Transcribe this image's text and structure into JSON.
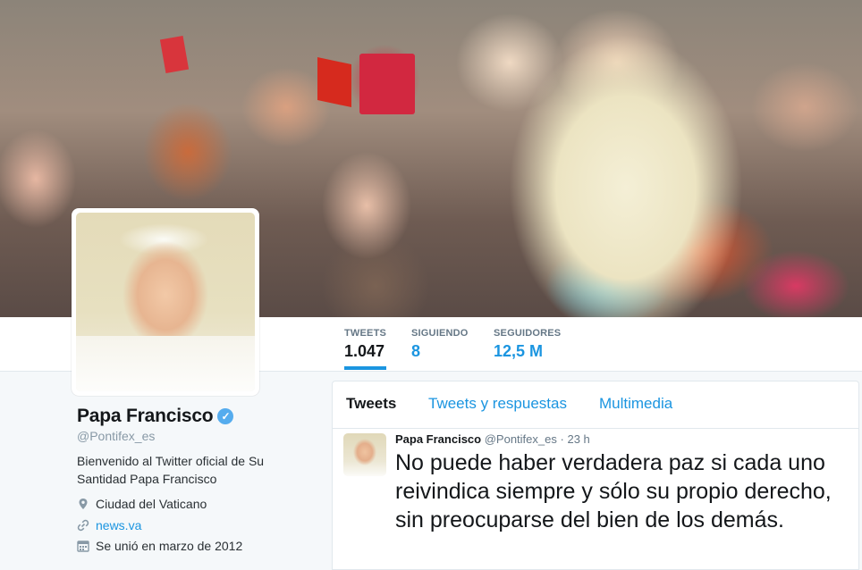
{
  "stats": [
    {
      "label": "TWEETS",
      "value": "1.047"
    },
    {
      "label": "SIGUIENDO",
      "value": "8"
    },
    {
      "label": "SEGUIDORES",
      "value": "12,5 M"
    }
  ],
  "profile": {
    "name": "Papa Francisco",
    "verified_icon": "verified-badge-icon",
    "handle": "@Pontifex_es",
    "bio": "Bienvenido al Twitter oficial de Su Santidad Papa Francisco",
    "location": "Ciudad del Vaticano",
    "website": "news.va",
    "joined": "Se unió en marzo de 2012"
  },
  "timeline": {
    "tabs": [
      "Tweets",
      "Tweets y respuestas",
      "Multimedia"
    ],
    "tweet": {
      "author": "Papa Francisco",
      "handle": "@Pontifex_es",
      "separator": "·",
      "time": "23 h",
      "text": "No puede haber verdadera paz si cada uno reivindica siempre y sólo su propio derecho, sin preocuparse del bien de los demás."
    }
  },
  "colors": {
    "accent": "#1b95e0",
    "verified": "#55acee"
  }
}
